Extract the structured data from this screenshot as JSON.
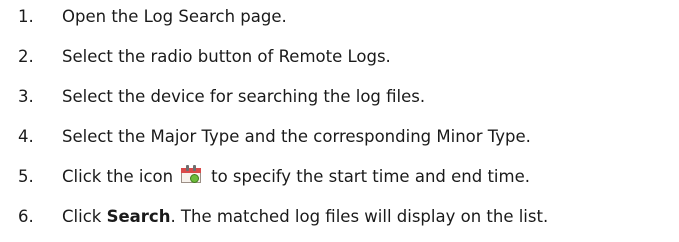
{
  "steps": [
    {
      "number": "1.",
      "text": "Open the Log Search page."
    },
    {
      "number": "2.",
      "text": "Select the radio button of Remote Logs."
    },
    {
      "number": "3.",
      "text": "Select the device for searching the log files."
    },
    {
      "number": "4.",
      "text": "Select the Major Type and the corresponding Minor Type."
    },
    {
      "number": "5.",
      "text_before_icon": "Click the icon",
      "icon": "calendar-clock-icon",
      "text_after_icon": "to specify the start time and end time."
    },
    {
      "number": "6.",
      "text_before_bold": "Click ",
      "bold": "Search",
      "text_after_bold": ". The matched log files will display on the list."
    }
  ]
}
